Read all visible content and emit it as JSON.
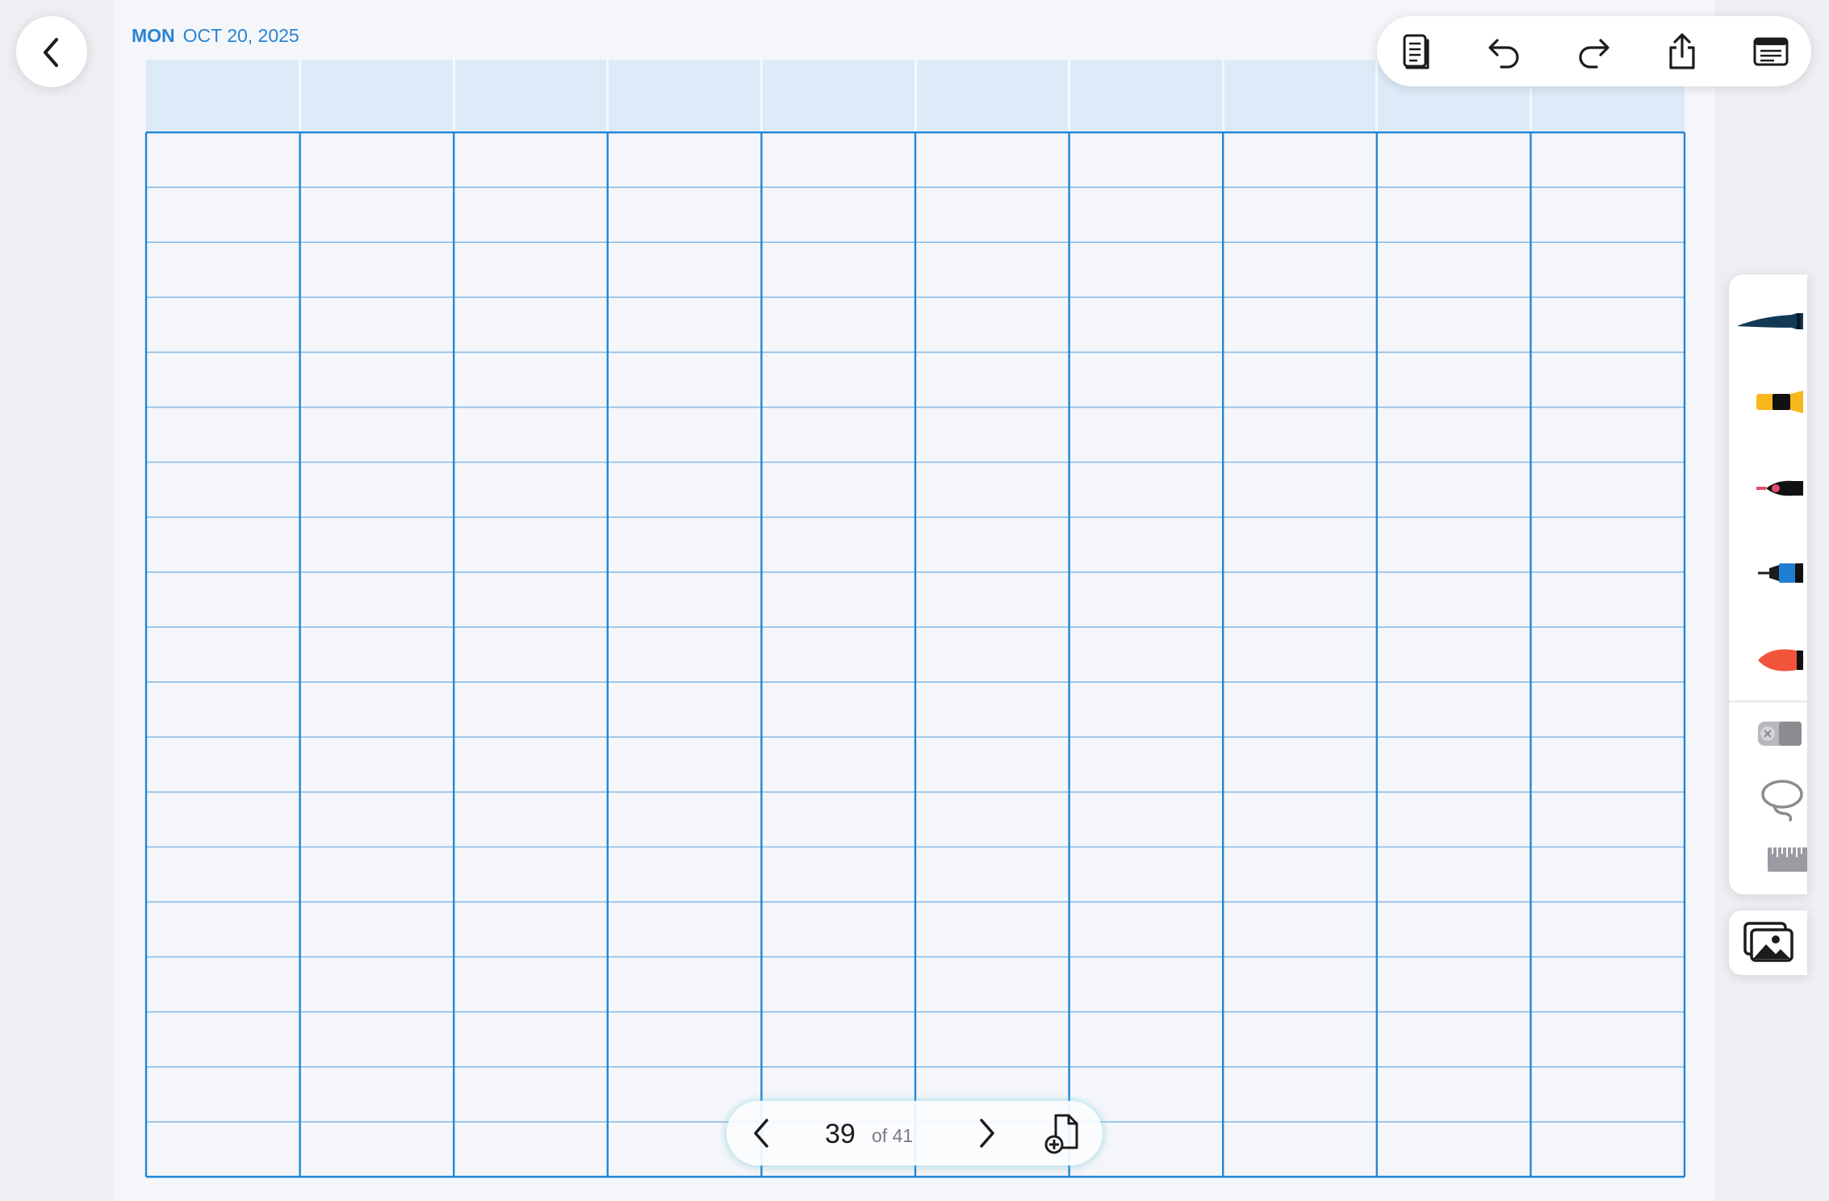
{
  "date_header": {
    "day": "MON",
    "date": "OCT 20, 2025"
  },
  "template": {
    "columns": 10,
    "rows": 19
  },
  "colors": {
    "accent": "#2a84d2",
    "grid_major": "#1f87d8",
    "grid_minor": "#8bbce6",
    "header_fill": "#ddeaf7"
  },
  "toolbar": {
    "buttons": [
      "pages-icon",
      "undo-icon",
      "redo-icon",
      "share-icon",
      "notes-icon"
    ]
  },
  "tools": [
    "fountain-pen",
    "highlighter",
    "calligraphy-pen",
    "fineliner",
    "brush",
    "eraser",
    "lasso",
    "ruler"
  ],
  "media": "photo-gallery-icon",
  "pager": {
    "current": "39",
    "total_text": "of 41"
  }
}
